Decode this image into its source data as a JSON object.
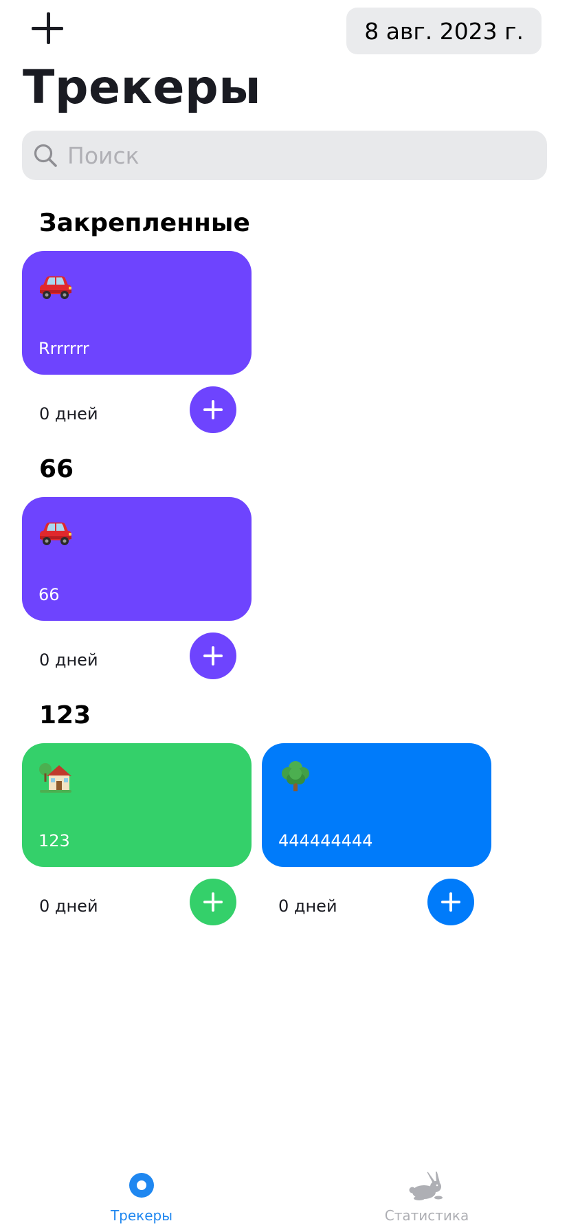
{
  "header": {
    "add_label": "+",
    "date": "8 авг. 2023 г.",
    "title": "Трекеры"
  },
  "search": {
    "placeholder": "Поиск",
    "value": ""
  },
  "colors": {
    "purple": "#6e44fe",
    "green": "#34d06a",
    "blue": "#007bfa",
    "tab_active": "#1f87f0",
    "tab_inactive": "#aeafb4"
  },
  "sections": [
    {
      "title": "Закрепленные",
      "trackers": [
        {
          "emoji": "car-icon",
          "name": "Rrrrrrr",
          "days": "0 дней",
          "color": "#6e44fe"
        }
      ]
    },
    {
      "title": "66",
      "trackers": [
        {
          "emoji": "car-icon",
          "name": "66",
          "days": "0 дней",
          "color": "#6e44fe"
        }
      ]
    },
    {
      "title": "123",
      "trackers": [
        {
          "emoji": "house-icon",
          "name": "123",
          "days": "0 дней",
          "color": "#34d06a"
        },
        {
          "emoji": "tree-icon",
          "name": "444444444",
          "days": "0 дней",
          "color": "#007bfa"
        }
      ]
    }
  ],
  "tabbar": {
    "trackers_label": "Трекеры",
    "stats_label": "Статистика"
  }
}
